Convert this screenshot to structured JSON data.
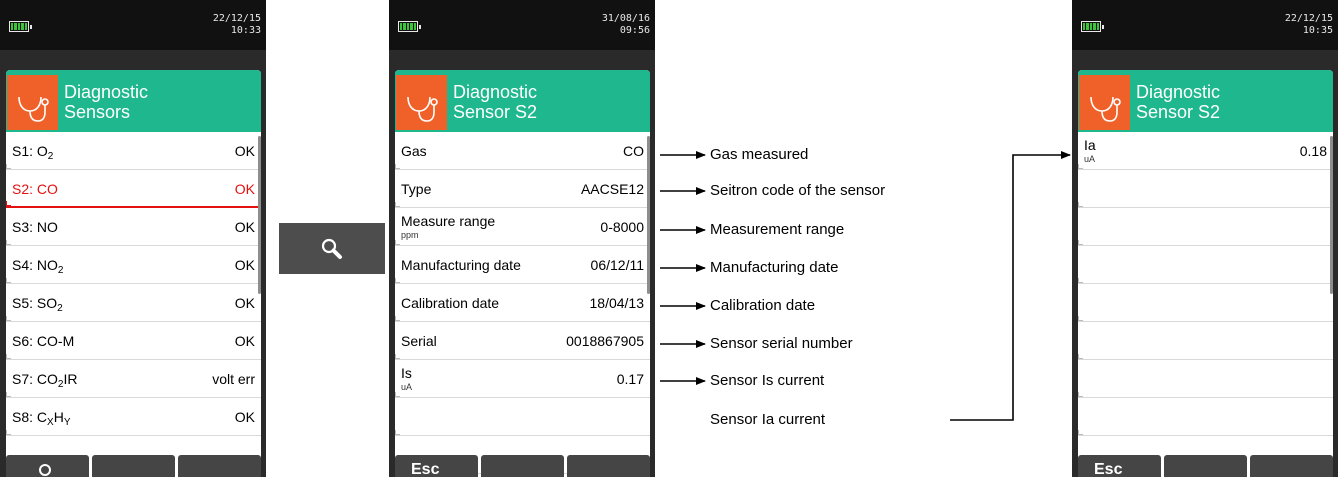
{
  "devices": {
    "left": {
      "date": "22/12/15",
      "time": "10:33",
      "title_line1": "Diagnostic",
      "title_line2": "Sensors",
      "rows": [
        {
          "label": "S1: O<sub>2</sub>",
          "value": "OK"
        },
        {
          "label": "S2: CO",
          "value": "OK"
        },
        {
          "label": "S3: NO",
          "value": "OK"
        },
        {
          "label": "S4: NO<sub>2</sub>",
          "value": "OK"
        },
        {
          "label": "S5: SO<sub>2</sub>",
          "value": "OK"
        },
        {
          "label": "S6: CO-M",
          "value": "OK"
        },
        {
          "label": "S7: CO<sub>2</sub>IR",
          "value": "volt err"
        },
        {
          "label": "S8: C<sub>X</sub>H<sub>Y</sub>",
          "value": "OK"
        }
      ],
      "softkeys": [
        "",
        "",
        ""
      ]
    },
    "middle": {
      "date": "31/08/16",
      "time": "09:56",
      "title_line1": "Diagnostic",
      "title_line2": "Sensor S2",
      "rows": [
        {
          "label": "Gas",
          "value": "CO"
        },
        {
          "label": "Type",
          "value": "AACSE12"
        },
        {
          "label": "Measure range",
          "unit": "ppm",
          "value": "0-8000"
        },
        {
          "label": "Manufacturing date",
          "value": "06/12/11"
        },
        {
          "label": "Calibration date",
          "value": "18/04/13"
        },
        {
          "label": "Serial",
          "value": "0018867905"
        },
        {
          "label": "Is",
          "unit": "uA",
          "value": "0.17"
        }
      ],
      "softkeys": [
        "Esc",
        "",
        ""
      ]
    },
    "right": {
      "date": "22/12/15",
      "time": "10:35",
      "title_line1": "Diagnostic",
      "title_line2": "Sensor S2",
      "rows": [
        {
          "label": "Ia",
          "unit": "uA",
          "value": "0.18"
        }
      ],
      "softkeys": [
        "Esc",
        "",
        ""
      ]
    }
  },
  "annotations": [
    "Gas measured",
    "Seitron code of the sensor",
    "Measurement range",
    "Manufacturing date",
    "Calibration date",
    "Sensor serial number",
    "Sensor Is current",
    "Sensor Ia current"
  ],
  "icons": {
    "header": "stethoscope-icon",
    "zoom": "magnifier-icon",
    "battery": "battery-icon"
  },
  "colors": {
    "header_bg": "#1fb78e",
    "icon_bg": "#f0612a",
    "selected": "#e41111"
  }
}
